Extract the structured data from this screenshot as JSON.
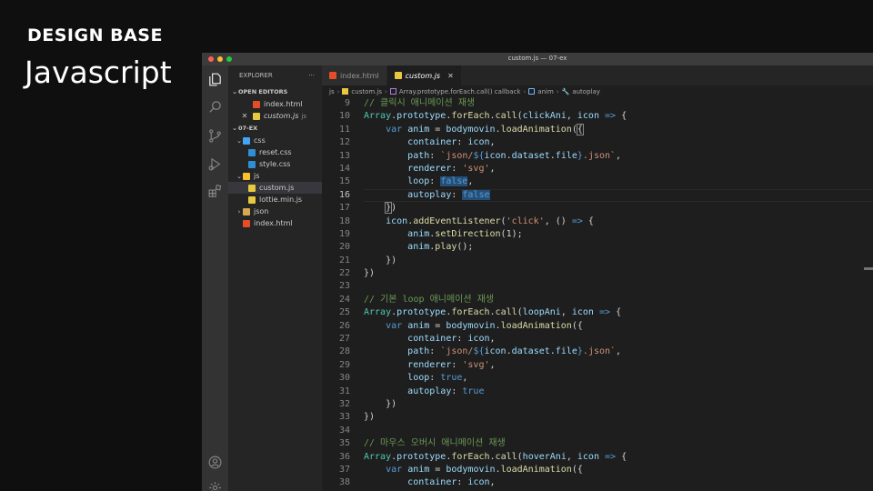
{
  "slide": {
    "brand": "DESIGN BASE",
    "heading": "Javascript"
  },
  "window": {
    "title": "custom.js — 07-ex"
  },
  "activity_bar": {
    "icons": [
      "files-icon",
      "search-icon",
      "source-control-icon",
      "run-debug-icon",
      "extensions-icon",
      "account-icon",
      "settings-gear-icon"
    ]
  },
  "sidebar": {
    "title": "EXPLORER",
    "more": "···",
    "open_editors_label": "OPEN EDITORS",
    "open_editors": [
      {
        "name": "index.html",
        "type": "html"
      },
      {
        "name": "custom.js",
        "type": "js",
        "suffix": "js",
        "close": "✕"
      }
    ],
    "project_label": "07-EX",
    "tree": [
      {
        "name": "css",
        "type": "folder-css",
        "depth": 1,
        "chev": "⌄"
      },
      {
        "name": "reset.css",
        "type": "css",
        "depth": 2
      },
      {
        "name": "style.css",
        "type": "css",
        "depth": 2
      },
      {
        "name": "js",
        "type": "folder-js",
        "depth": 1,
        "chev": "⌄"
      },
      {
        "name": "custom.js",
        "type": "js",
        "depth": 2,
        "active": true
      },
      {
        "name": "lottie.min.js",
        "type": "js",
        "depth": 2
      },
      {
        "name": "json",
        "type": "folder-json",
        "depth": 1,
        "chev": "›"
      },
      {
        "name": "index.html",
        "type": "html",
        "depth": 1
      }
    ]
  },
  "tabs": [
    {
      "label": "index.html",
      "type": "html",
      "active": false
    },
    {
      "label": "custom.js",
      "type": "js",
      "active": true,
      "close": "✕"
    }
  ],
  "breadcrumb": [
    "js",
    "custom.js",
    "Array.prototype.forEach.call() callback",
    "anim",
    "autoplay"
  ],
  "code": {
    "current_line": 16,
    "lines": [
      {
        "n": 9,
        "t": [
          [
            "c",
            "// 클릭시 애니메이션 재생"
          ]
        ]
      },
      {
        "n": 10,
        "t": [
          [
            "t",
            "Array"
          ],
          [
            "d",
            "."
          ],
          [
            "p",
            "prototype"
          ],
          [
            "d",
            "."
          ],
          [
            "f",
            "forEach"
          ],
          [
            "d",
            "."
          ],
          [
            "f",
            "call"
          ],
          [
            "d",
            "("
          ],
          [
            "p",
            "clickAni"
          ],
          [
            "d",
            ", "
          ],
          [
            "p",
            "icon"
          ],
          [
            "d",
            " "
          ],
          [
            "k",
            "=>"
          ],
          [
            "d",
            " {"
          ]
        ]
      },
      {
        "n": 11,
        "t": [
          [
            "d",
            "    "
          ],
          [
            "k",
            "var"
          ],
          [
            "d",
            " "
          ],
          [
            "p",
            "anim"
          ],
          [
            "d",
            " = "
          ],
          [
            "p",
            "bodymovin"
          ],
          [
            "d",
            "."
          ],
          [
            "f",
            "loadAnimation"
          ],
          [
            "d",
            "("
          ],
          [
            "br",
            "{"
          ]
        ]
      },
      {
        "n": 12,
        "t": [
          [
            "d",
            "        "
          ],
          [
            "p",
            "container"
          ],
          [
            "d",
            ": "
          ],
          [
            "p",
            "icon"
          ],
          [
            "d",
            ","
          ]
        ]
      },
      {
        "n": 13,
        "t": [
          [
            "d",
            "        "
          ],
          [
            "p",
            "path"
          ],
          [
            "d",
            ": "
          ],
          [
            "s",
            "`json/"
          ],
          [
            "k",
            "${"
          ],
          [
            "p",
            "icon"
          ],
          [
            "d",
            "."
          ],
          [
            "p",
            "dataset"
          ],
          [
            "d",
            "."
          ],
          [
            "p",
            "file"
          ],
          [
            "k",
            "}"
          ],
          [
            "s",
            ".json`"
          ],
          [
            "d",
            ","
          ]
        ]
      },
      {
        "n": 14,
        "t": [
          [
            "d",
            "        "
          ],
          [
            "p",
            "renderer"
          ],
          [
            "d",
            ": "
          ],
          [
            "s",
            "'svg'"
          ],
          [
            "d",
            ","
          ]
        ]
      },
      {
        "n": 15,
        "t": [
          [
            "d",
            "        "
          ],
          [
            "p",
            "loop"
          ],
          [
            "d",
            ": "
          ],
          [
            "khl",
            "false"
          ],
          [
            "d",
            ","
          ]
        ]
      },
      {
        "n": 16,
        "t": [
          [
            "d",
            "        "
          ],
          [
            "p",
            "autoplay"
          ],
          [
            "d",
            ": "
          ],
          [
            "khl",
            "false"
          ]
        ]
      },
      {
        "n": 17,
        "t": [
          [
            "d",
            "    "
          ],
          [
            "br",
            "}"
          ],
          [
            "d",
            ")"
          ]
        ]
      },
      {
        "n": 18,
        "t": [
          [
            "d",
            "    "
          ],
          [
            "p",
            "icon"
          ],
          [
            "d",
            "."
          ],
          [
            "f",
            "addEventListener"
          ],
          [
            "d",
            "("
          ],
          [
            "s",
            "'click'"
          ],
          [
            "d",
            ", () "
          ],
          [
            "k",
            "=>"
          ],
          [
            "d",
            " {"
          ]
        ]
      },
      {
        "n": 19,
        "t": [
          [
            "d",
            "        "
          ],
          [
            "p",
            "anim"
          ],
          [
            "d",
            "."
          ],
          [
            "f",
            "setDirection"
          ],
          [
            "d",
            "(1);"
          ]
        ]
      },
      {
        "n": 20,
        "t": [
          [
            "d",
            "        "
          ],
          [
            "p",
            "anim"
          ],
          [
            "d",
            "."
          ],
          [
            "f",
            "play"
          ],
          [
            "d",
            "();"
          ]
        ]
      },
      {
        "n": 21,
        "t": [
          [
            "d",
            "    })"
          ]
        ]
      },
      {
        "n": 22,
        "t": [
          [
            "d",
            "})"
          ]
        ]
      },
      {
        "n": 23,
        "t": []
      },
      {
        "n": 24,
        "t": [
          [
            "c",
            "// 기본 loop 애니메이션 재생"
          ]
        ]
      },
      {
        "n": 25,
        "t": [
          [
            "t",
            "Array"
          ],
          [
            "d",
            "."
          ],
          [
            "p",
            "prototype"
          ],
          [
            "d",
            "."
          ],
          [
            "f",
            "forEach"
          ],
          [
            "d",
            "."
          ],
          [
            "f",
            "call"
          ],
          [
            "d",
            "("
          ],
          [
            "p",
            "loopAni"
          ],
          [
            "d",
            ", "
          ],
          [
            "p",
            "icon"
          ],
          [
            "d",
            " "
          ],
          [
            "k",
            "=>"
          ],
          [
            "d",
            " {"
          ]
        ]
      },
      {
        "n": 26,
        "t": [
          [
            "d",
            "    "
          ],
          [
            "k",
            "var"
          ],
          [
            "d",
            " "
          ],
          [
            "p",
            "anim"
          ],
          [
            "d",
            " = "
          ],
          [
            "p",
            "bodymovin"
          ],
          [
            "d",
            "."
          ],
          [
            "f",
            "loadAnimation"
          ],
          [
            "d",
            "({"
          ]
        ]
      },
      {
        "n": 27,
        "t": [
          [
            "d",
            "        "
          ],
          [
            "p",
            "container"
          ],
          [
            "d",
            ": "
          ],
          [
            "p",
            "icon"
          ],
          [
            "d",
            ","
          ]
        ]
      },
      {
        "n": 28,
        "t": [
          [
            "d",
            "        "
          ],
          [
            "p",
            "path"
          ],
          [
            "d",
            ": "
          ],
          [
            "s",
            "`json/"
          ],
          [
            "k",
            "${"
          ],
          [
            "p",
            "icon"
          ],
          [
            "d",
            "."
          ],
          [
            "p",
            "dataset"
          ],
          [
            "d",
            "."
          ],
          [
            "p",
            "file"
          ],
          [
            "k",
            "}"
          ],
          [
            "s",
            ".json`"
          ],
          [
            "d",
            ","
          ]
        ]
      },
      {
        "n": 29,
        "t": [
          [
            "d",
            "        "
          ],
          [
            "p",
            "renderer"
          ],
          [
            "d",
            ": "
          ],
          [
            "s",
            "'svg'"
          ],
          [
            "d",
            ","
          ]
        ]
      },
      {
        "n": 30,
        "t": [
          [
            "d",
            "        "
          ],
          [
            "p",
            "loop"
          ],
          [
            "d",
            ": "
          ],
          [
            "k",
            "true"
          ],
          [
            "d",
            ","
          ]
        ]
      },
      {
        "n": 31,
        "t": [
          [
            "d",
            "        "
          ],
          [
            "p",
            "autoplay"
          ],
          [
            "d",
            ": "
          ],
          [
            "k",
            "true"
          ]
        ]
      },
      {
        "n": 32,
        "t": [
          [
            "d",
            "    })"
          ]
        ]
      },
      {
        "n": 33,
        "t": [
          [
            "d",
            "})"
          ]
        ]
      },
      {
        "n": 34,
        "t": []
      },
      {
        "n": 35,
        "t": [
          [
            "c",
            "// 마우스 오버시 애니메이션 재생"
          ]
        ]
      },
      {
        "n": 36,
        "t": [
          [
            "t",
            "Array"
          ],
          [
            "d",
            "."
          ],
          [
            "p",
            "prototype"
          ],
          [
            "d",
            "."
          ],
          [
            "f",
            "forEach"
          ],
          [
            "d",
            "."
          ],
          [
            "f",
            "call"
          ],
          [
            "d",
            "("
          ],
          [
            "p",
            "hoverAni"
          ],
          [
            "d",
            ", "
          ],
          [
            "p",
            "icon"
          ],
          [
            "d",
            " "
          ],
          [
            "k",
            "=>"
          ],
          [
            "d",
            " {"
          ]
        ]
      },
      {
        "n": 37,
        "t": [
          [
            "d",
            "    "
          ],
          [
            "k",
            "var"
          ],
          [
            "d",
            " "
          ],
          [
            "p",
            "anim"
          ],
          [
            "d",
            " = "
          ],
          [
            "p",
            "bodymovin"
          ],
          [
            "d",
            "."
          ],
          [
            "f",
            "loadAnimation"
          ],
          [
            "d",
            "({"
          ]
        ]
      },
      {
        "n": 38,
        "t": [
          [
            "d",
            "        "
          ],
          [
            "p",
            "container"
          ],
          [
            "d",
            ": "
          ],
          [
            "p",
            "icon"
          ],
          [
            "d",
            ","
          ]
        ]
      }
    ]
  }
}
